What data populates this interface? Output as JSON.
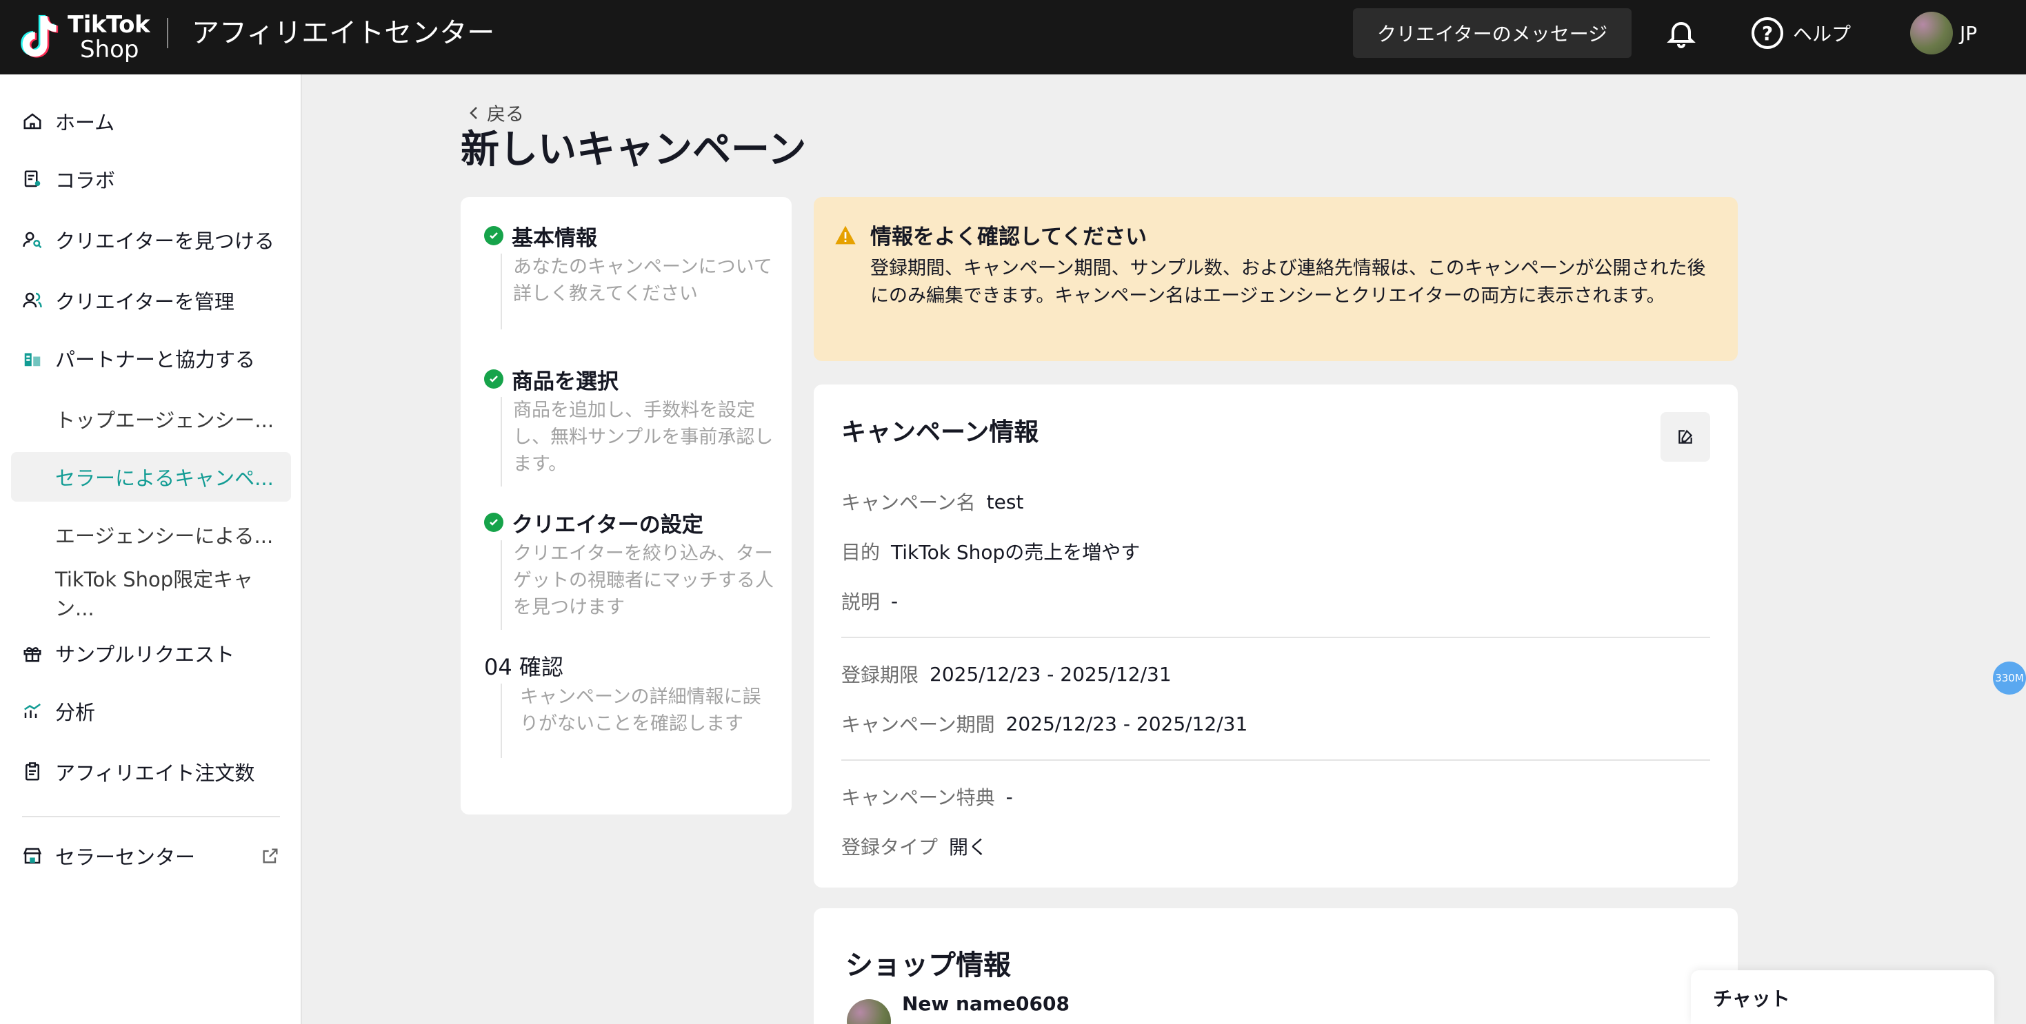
{
  "header": {
    "brand_line1": "TikTok",
    "brand_line2": "Shop",
    "app_title": "アフィリエイトセンター",
    "messages_button": "クリエイターのメッセージ",
    "help_label": "ヘルプ",
    "user_label": "JP"
  },
  "sidebar": {
    "items": [
      {
        "label": "ホーム",
        "icon": "home-icon"
      },
      {
        "label": "コラボ",
        "icon": "collab-icon"
      },
      {
        "label": "クリエイターを見つける",
        "icon": "find-creator-icon"
      },
      {
        "label": "クリエイターを管理",
        "icon": "manage-creator-icon"
      },
      {
        "label": "パートナーと協力する",
        "icon": "partner-icon"
      },
      {
        "label": "トップエージェンシー..."
      },
      {
        "label": "セラーによるキャンペ..."
      },
      {
        "label": "エージェンシーによる..."
      },
      {
        "label": "TikTok Shop限定キャン..."
      },
      {
        "label": "サンプルリクエスト",
        "icon": "gift-icon"
      },
      {
        "label": "分析",
        "icon": "analytics-icon"
      },
      {
        "label": "アフィリエイト注文数",
        "icon": "clipboard-icon"
      },
      {
        "label": "セラーセンター",
        "icon": "store-icon"
      }
    ],
    "active_index": 6
  },
  "main": {
    "back_label": "戻る",
    "page_title": "新しいキャンペーン",
    "steps": [
      {
        "title": "基本情報",
        "desc": "あなたのキャンペーンについて詳しく教えてください",
        "done": true
      },
      {
        "title": "商品を選択",
        "desc": "商品を追加し、手数料を設定し、無料サンプルを事前承認します。",
        "done": true
      },
      {
        "title": "クリエイターの設定",
        "desc": "クリエイターを絞り込み、ターゲットの視聴者にマッチする人を見つけます",
        "done": true
      },
      {
        "title": "04 確認",
        "desc": "キャンペーンの詳細情報に誤りがないことを確認します",
        "done": false
      }
    ],
    "warning": {
      "title": "情報をよく確認してください",
      "body": "登録期間、キャンペーン期間、サンプル数、および連絡先情報は、このキャンペーンが公開された後にのみ編集できます。キャンペーン名はエージェンシーとクリエイターの両方に表示されます。"
    },
    "campaign_info": {
      "title": "キャンペーン情報",
      "name_label": "キャンペーン名",
      "name_value": "test",
      "goal_label": "目的",
      "goal_value": "TikTok Shopの売上を増やす",
      "desc_label": "説明",
      "desc_value": "-",
      "reg_label": "登録期限",
      "reg_value": "2025/12/23 - 2025/12/31",
      "period_label": "キャンペーン期間",
      "period_value": "2025/12/23 - 2025/12/31",
      "benefit_label": "キャンペーン特典",
      "benefit_value": "-",
      "type_label": "登録タイプ",
      "type_value": "開く"
    },
    "shop_info": {
      "title": "ショップ情報",
      "shop_name": "New name0608"
    }
  },
  "chat_label": "チャット",
  "memory_badge": "330M",
  "colors": {
    "accent": "#129c94",
    "warning_bg": "#fbe9c6",
    "check_green": "#16a34a",
    "topbar_bg": "#171717"
  }
}
